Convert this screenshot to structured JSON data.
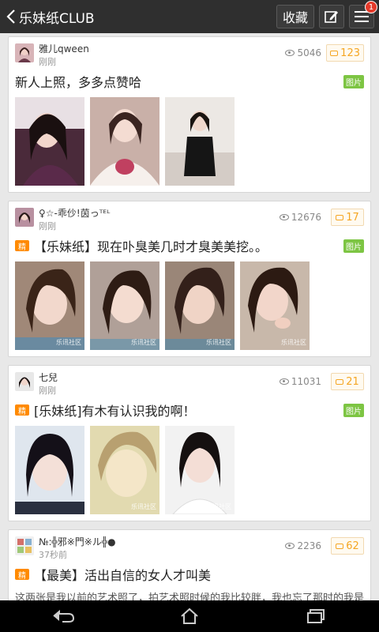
{
  "header": {
    "title": "乐妹纸CLUB",
    "favorite_label": "收藏",
    "notification_count": "1"
  },
  "posts": [
    {
      "username": "雅儿qween",
      "time": "刚刚",
      "views": "5046",
      "comments": "123",
      "featured": false,
      "title": "新人上照，多多点赞哈",
      "image_tag": "图片",
      "thumb_colors": [
        "#4a2a3a",
        "#c9a7a0",
        "#6b5a55"
      ]
    },
    {
      "username": "♀☆-乖仯!茵っᵀᴱᴸ",
      "time": "刚刚",
      "views": "12676",
      "comments": "17",
      "featured": true,
      "featured_label": "精",
      "title": "【乐妹纸】现在卟臭美几时才臭美美挖。。",
      "image_tag": "图片",
      "watermark": "乐讯社区",
      "thumb_colors": [
        "#7a5a4a",
        "#8a6a5a",
        "#9a7a68",
        "#6a5046"
      ]
    },
    {
      "username": "七兒",
      "time": "刚刚",
      "views": "11031",
      "comments": "21",
      "featured": true,
      "featured_label": "精",
      "title": "[乐妹纸]有木有认识我的啊！",
      "image_tag": "图片",
      "watermark": "乐讯社区",
      "thumb_colors": [
        "#2a2a3a",
        "#d8d0a8",
        "#3a3030"
      ]
    },
    {
      "username": "№:╬邪※門※ル╬●",
      "time": "37秒前",
      "views": "2236",
      "comments": "62",
      "featured": true,
      "featured_label": "精",
      "title": "【最美】活出自信的女人才叫美",
      "snippet": "这两张是我以前的艺术照了，拍艺术照时候的我比较胖，我也忘了那时的我是有多少斤了。这张不知道的人还以为是化妆的呢，其实没有，只是家"
    }
  ],
  "navbar": {
    "icons": [
      "back-icon",
      "home-icon",
      "recent-apps-icon"
    ]
  }
}
